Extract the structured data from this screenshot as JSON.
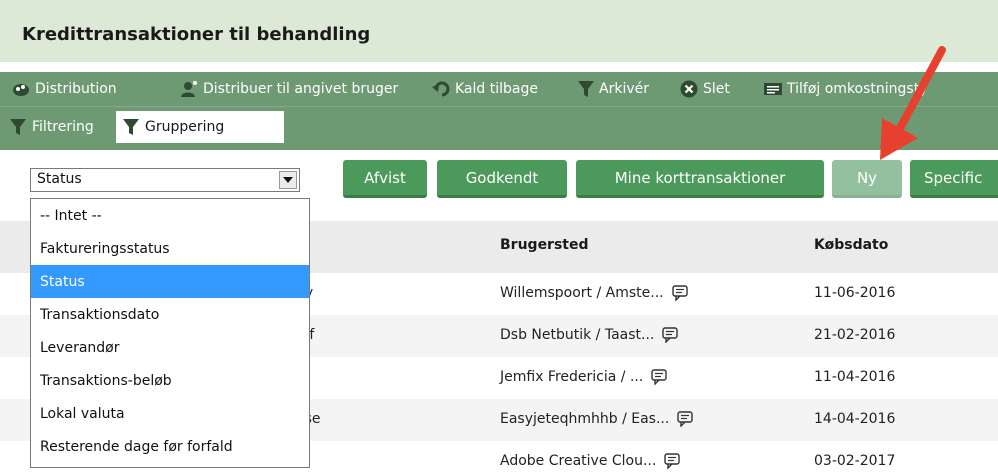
{
  "page": {
    "title": "Kredittransaktioner til behandling"
  },
  "toolbar": {
    "items": [
      {
        "label": "Distribution",
        "icon": "distribution-icon"
      },
      {
        "label": "Distribuer til angivet bruger",
        "icon": "user-distribute-icon"
      },
      {
        "label": "Kald tilbage",
        "icon": "undo-icon"
      },
      {
        "label": "Arkivér",
        "icon": "funnel-icon"
      },
      {
        "label": "Slet",
        "icon": "close-circle-icon"
      },
      {
        "label": "Tilføj omkostningsty",
        "icon": "list-icon"
      }
    ]
  },
  "filter_bar": {
    "filtering_label": "Filtrering",
    "grouping_label": "Gruppering"
  },
  "group_select": {
    "value": "Status",
    "options": [
      "-- Intet --",
      "Faktureringsstatus",
      "Status",
      "Transaktionsdato",
      "Leverandør",
      "Transaktions-beløb",
      "Lokal valuta",
      "Resterende dage før forfald"
    ],
    "selected_index": 2
  },
  "status_buttons": [
    {
      "label": "Afvist"
    },
    {
      "label": "Godkendt"
    },
    {
      "label": "Mine korttransaktioner"
    },
    {
      "label": "Ny"
    },
    {
      "label": "Specific"
    }
  ],
  "table": {
    "columns": {
      "brugersted": "Brugersted",
      "kobsdato": "Købsdato"
    },
    "rows": [
      {
        "partial": "by",
        "brugersted": "Willemspoort / Amste...",
        "kobsdato": "11-06-2016"
      },
      {
        "partial": "off",
        "brugersted": "Dsb Netbutik / Taast...",
        "kobsdato": "21-02-2016"
      },
      {
        "partial": "",
        "brugersted": "Jemfix Fredericia / ...",
        "kobsdato": "11-04-2016"
      },
      {
        "partial": "ose",
        "brugersted": "Easyjeteqhmhhb / Eas...",
        "kobsdato": "14-04-2016"
      },
      {
        "partial": "",
        "brugersted": "Adobe Creative Clou...",
        "kobsdato": "03-02-2017"
      }
    ]
  },
  "colors": {
    "header_bg": "#dde9d7",
    "toolbar_bg": "#6d9a73",
    "button_green": "#4c9a5b",
    "button_light": "#93c1a0",
    "selection_blue": "#3399ff",
    "annotation_arrow": "#e8402f"
  }
}
